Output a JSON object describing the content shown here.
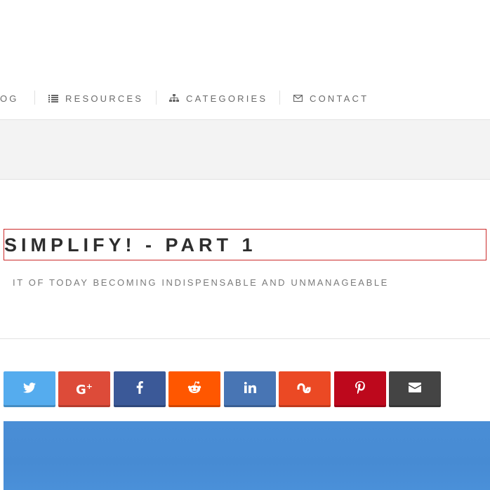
{
  "nav": {
    "items": [
      {
        "label": "OG",
        "icon": "none"
      },
      {
        "label": "RESOURCES",
        "icon": "list-icon"
      },
      {
        "label": "CATEGORIES",
        "icon": "sitemap-icon"
      },
      {
        "label": "CONTACT",
        "icon": "envelope-icon"
      }
    ]
  },
  "post": {
    "title": "SIMPLIFY! - PART 1",
    "subtitle": "IT OF TODAY BECOMING INDISPENSABLE AND UNMANAGEABLE"
  },
  "share": {
    "buttons": [
      {
        "network": "twitter",
        "icon": "twitter-icon",
        "color": "#55acee"
      },
      {
        "network": "google-plus",
        "icon": "google-plus-icon",
        "color": "#dd4b39"
      },
      {
        "network": "facebook",
        "icon": "facebook-icon",
        "color": "#3b5998"
      },
      {
        "network": "reddit",
        "icon": "reddit-icon",
        "color": "#ff5700"
      },
      {
        "network": "linkedin",
        "icon": "linkedin-icon",
        "color": "#4875b4"
      },
      {
        "network": "stumbleupon",
        "icon": "stumbleupon-icon",
        "color": "#eb4924"
      },
      {
        "network": "pinterest",
        "icon": "pinterest-icon",
        "color": "#bd081c"
      },
      {
        "network": "email",
        "icon": "envelope-icon",
        "color": "#444444"
      }
    ]
  },
  "colors": {
    "accent_border": "#cc2b2b",
    "hero_sky": "#4a8ed6"
  }
}
